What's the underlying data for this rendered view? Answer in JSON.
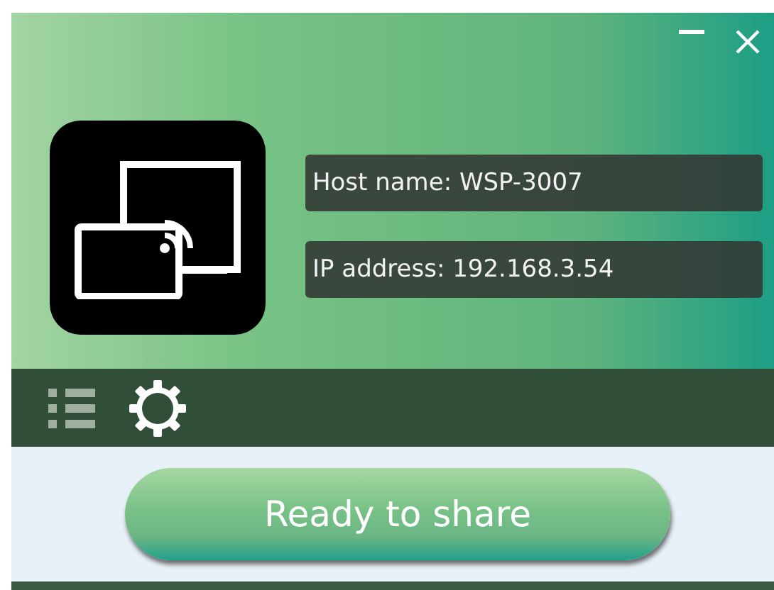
{
  "fields": [
    {
      "text": "Host name: WSP-3007"
    },
    {
      "text": "IP address: 192.168.3.54"
    }
  ],
  "share_button": {
    "label": "Ready to share"
  }
}
